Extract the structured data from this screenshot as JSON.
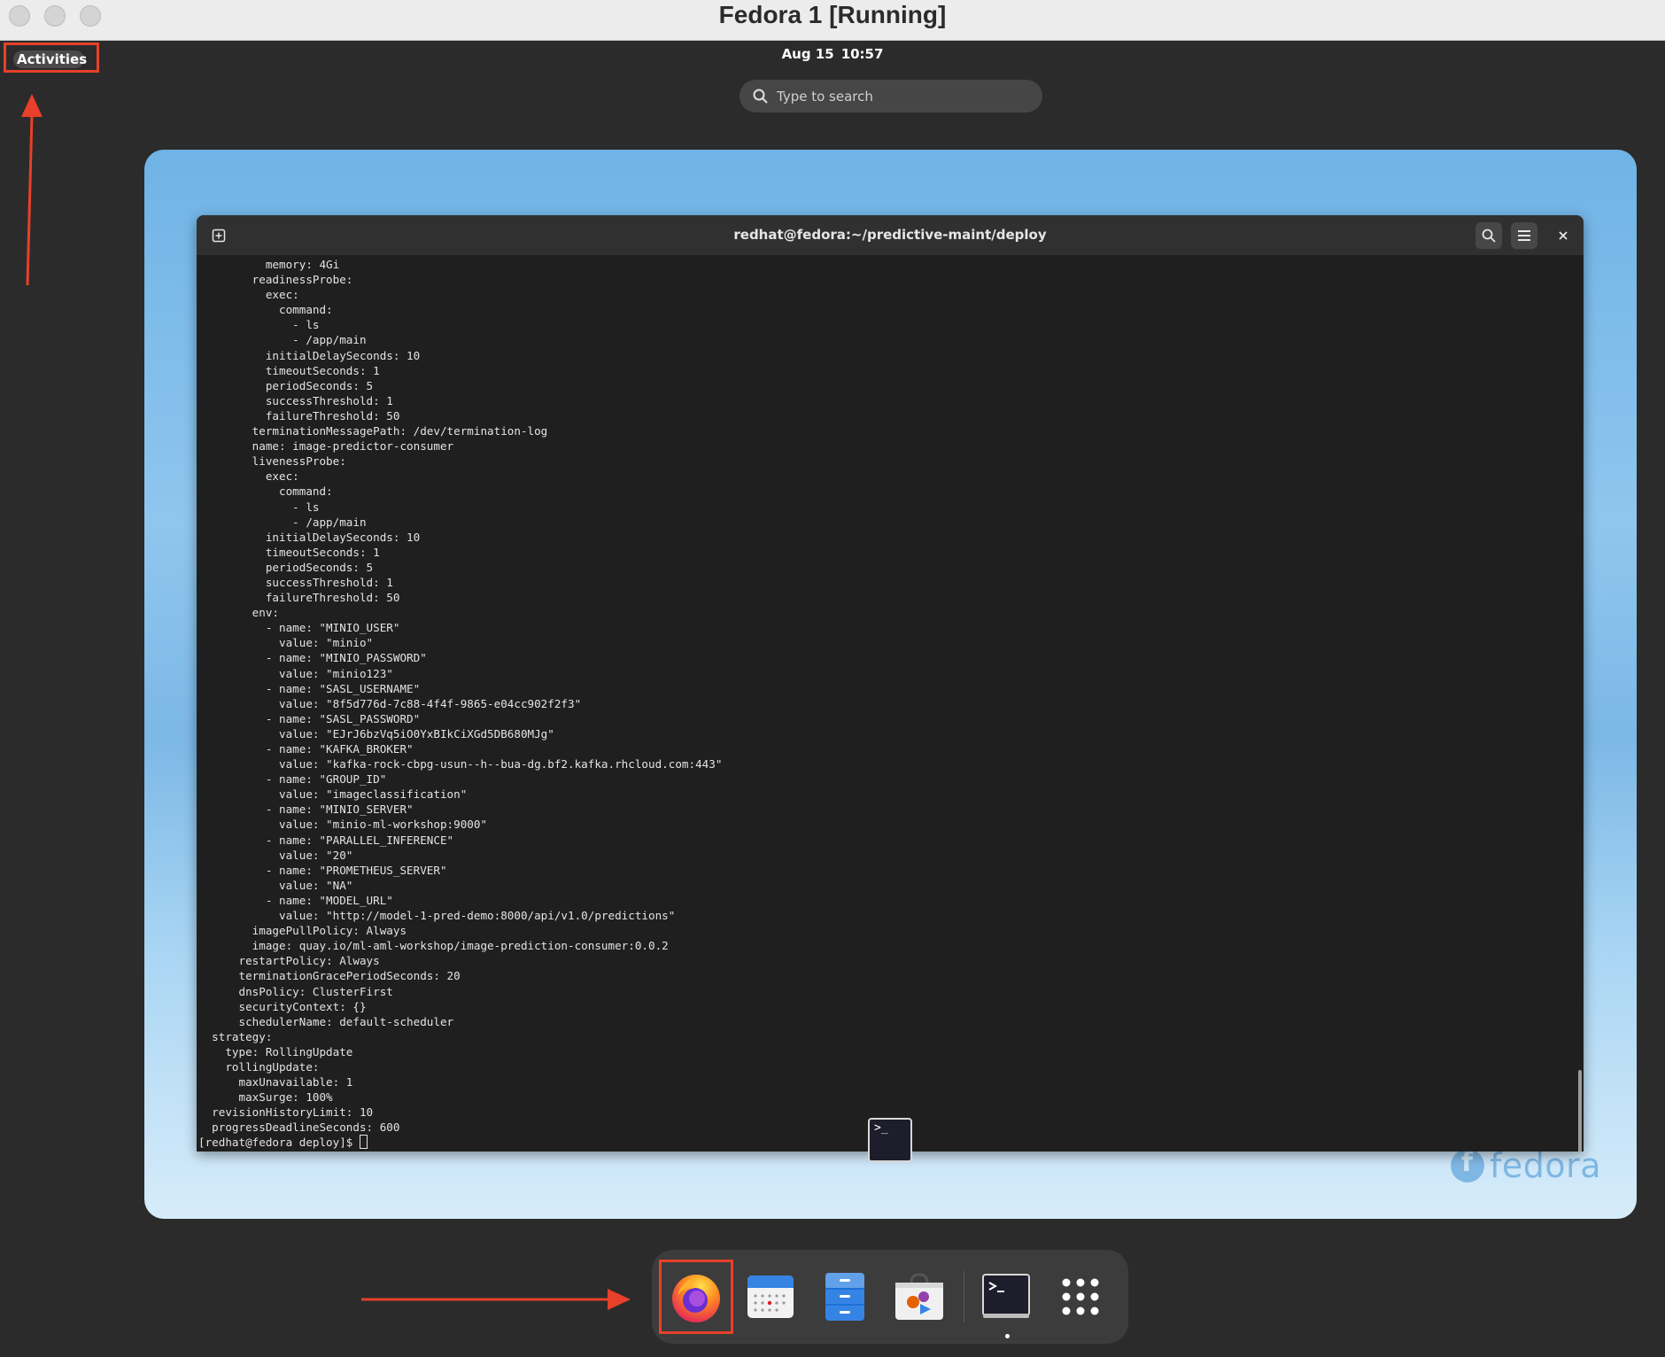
{
  "host": {
    "title": "Fedora 1 [Running]"
  },
  "topbar": {
    "activities_label": "Activities",
    "date": "Aug 15",
    "time": "10:57"
  },
  "search": {
    "placeholder": "Type to search"
  },
  "terminal": {
    "title": "redhat@fedora:~/predictive-maint/deploy",
    "lines": [
      "          memory: 4Gi",
      "        readinessProbe:",
      "          exec:",
      "            command:",
      "              - ls",
      "              - /app/main",
      "          initialDelaySeconds: 10",
      "          timeoutSeconds: 1",
      "          periodSeconds: 5",
      "          successThreshold: 1",
      "          failureThreshold: 50",
      "        terminationMessagePath: /dev/termination-log",
      "        name: image-predictor-consumer",
      "        livenessProbe:",
      "          exec:",
      "            command:",
      "              - ls",
      "              - /app/main",
      "          initialDelaySeconds: 10",
      "          timeoutSeconds: 1",
      "          periodSeconds: 5",
      "          successThreshold: 1",
      "          failureThreshold: 50",
      "        env:",
      "          - name: \"MINIO_USER\"",
      "            value: \"minio\"",
      "          - name: \"MINIO_PASSWORD\"",
      "            value: \"minio123\"",
      "          - name: \"SASL_USERNAME\"",
      "            value: \"8f5d776d-7c88-4f4f-9865-e04cc902f2f3\"",
      "          - name: \"SASL_PASSWORD\"",
      "            value: \"EJrJ6bzVq5iO0YxBIkCiXGd5DB680MJg\"",
      "          - name: \"KAFKA_BROKER\"",
      "            value: \"kafka-rock-cbpg-usun--h--bua-dg.bf2.kafka.rhcloud.com:443\"",
      "          - name: \"GROUP_ID\"",
      "            value: \"imageclassification\"",
      "          - name: \"MINIO_SERVER\"",
      "            value: \"minio-ml-workshop:9000\"",
      "          - name: \"PARALLEL_INFERENCE\"",
      "            value: \"20\"",
      "          - name: \"PROMETHEUS_SERVER\"",
      "            value: \"NA\"",
      "          - name: \"MODEL_URL\"",
      "            value: \"http://model-1-pred-demo:8000/api/v1.0/predictions\"",
      "        imagePullPolicy: Always",
      "        image: quay.io/ml-aml-workshop/image-prediction-consumer:0.0.2",
      "      restartPolicy: Always",
      "      terminationGracePeriodSeconds: 20",
      "      dnsPolicy: ClusterFirst",
      "      securityContext: {}",
      "      schedulerName: default-scheduler",
      "  strategy:",
      "    type: RollingUpdate",
      "    rollingUpdate:",
      "      maxUnavailable: 1",
      "      maxSurge: 100%",
      "  revisionHistoryLimit: 10",
      "  progressDeadlineSeconds: 600"
    ],
    "prompt": "[redhat@fedora deploy]$ "
  },
  "watermark": {
    "text": "fedora"
  },
  "dock": {
    "items": [
      {
        "name": "firefox",
        "icon": "firefox-icon"
      },
      {
        "name": "calendar",
        "icon": "calendar-icon"
      },
      {
        "name": "files",
        "icon": "files-icon"
      },
      {
        "name": "software",
        "icon": "software-icon"
      },
      {
        "name": "terminal",
        "icon": "terminal-icon"
      },
      {
        "name": "app-grid",
        "icon": "app-grid-icon"
      }
    ]
  },
  "colors": {
    "annotation": "#e8402a",
    "terminal_bg": "#1f1f1f",
    "accent": "#3584e4"
  }
}
